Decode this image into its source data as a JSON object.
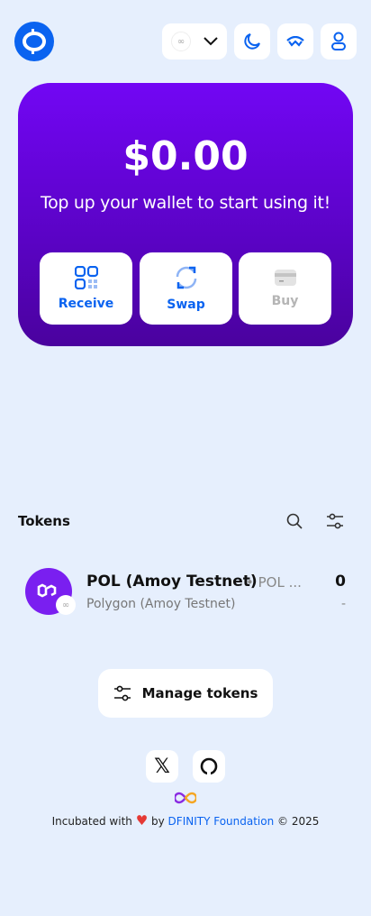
{
  "header": {
    "network_selector": "chain-icon",
    "theme": "moon-icon",
    "walletconnect": "walletconnect-icon",
    "profile": "user-icon"
  },
  "balance": {
    "amount": "$0.00",
    "message": "Top up your wallet to start using it!"
  },
  "actions": [
    {
      "label": "Receive"
    },
    {
      "label": "Swap"
    },
    {
      "label": "Buy"
    }
  ],
  "tokens": {
    "title": "Tokens",
    "items": [
      {
        "name": "POL (Amoy Testnet)",
        "symbol": "POL ...",
        "network": "Polygon (Amoy Testnet)",
        "balance": "0",
        "usd": "-"
      }
    ],
    "manage_label": "Manage tokens"
  },
  "footer": {
    "prefix": "Incubated with",
    "by": "by",
    "org": "DFINITY Foundation",
    "copyright": "© 2025"
  },
  "colors": {
    "accent": "#0a63f0",
    "card": "#6a05e8",
    "background": "#e6effd"
  }
}
